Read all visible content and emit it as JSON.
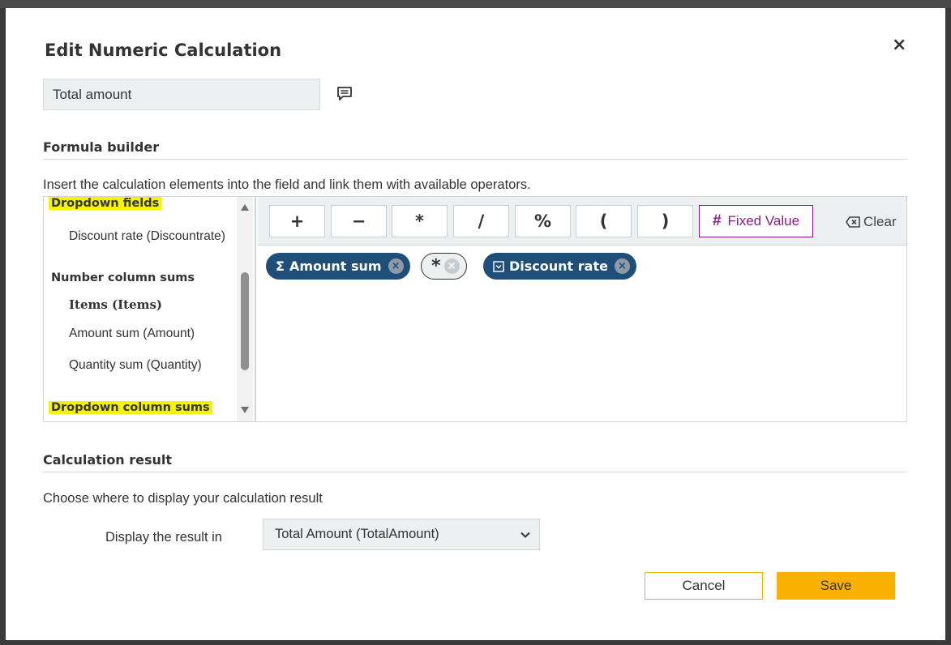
{
  "dialog": {
    "title": "Edit Numeric Calculation",
    "close_label": "×",
    "name_value": "Total amount"
  },
  "formula_builder": {
    "heading": "Formula builder",
    "description": "Insert the calculation elements into the field and link them with available operators.",
    "groups": {
      "dropdown_fields": "Dropdown fields",
      "discount_rate": "Discount rate (Discountrate)",
      "number_column_sums": "Number column sums",
      "items_table": "Items (Items)",
      "amount_sum": "Amount sum (Amount)",
      "quantity_sum": "Quantity sum (Quantity)",
      "dropdown_column_sums": "Dropdown column sums"
    },
    "operators": [
      "+",
      "−",
      "*",
      "/",
      "%",
      "(",
      ")"
    ],
    "fixed_value_label": "Fixed Value",
    "fixed_value_icon": "#",
    "clear_label": "Clear",
    "formula": {
      "chip1_icon": "Σ",
      "chip1_label": "Amount sum",
      "chip2_label": "*",
      "chip3_label": "Discount rate",
      "remove_glyph": "×"
    }
  },
  "calculation_result": {
    "heading": "Calculation result",
    "description": "Choose where to display your calculation result",
    "display_label": "Display the result in",
    "selected_value": "Total Amount (TotalAmount)"
  },
  "actions": {
    "cancel": "Cancel",
    "save": "Save"
  },
  "colors": {
    "chip_blue": "#1f4e79",
    "highlight_yellow": "#f4f400",
    "fixed_value_purple": "#8c1a8c",
    "save_orange": "#fbb100"
  }
}
